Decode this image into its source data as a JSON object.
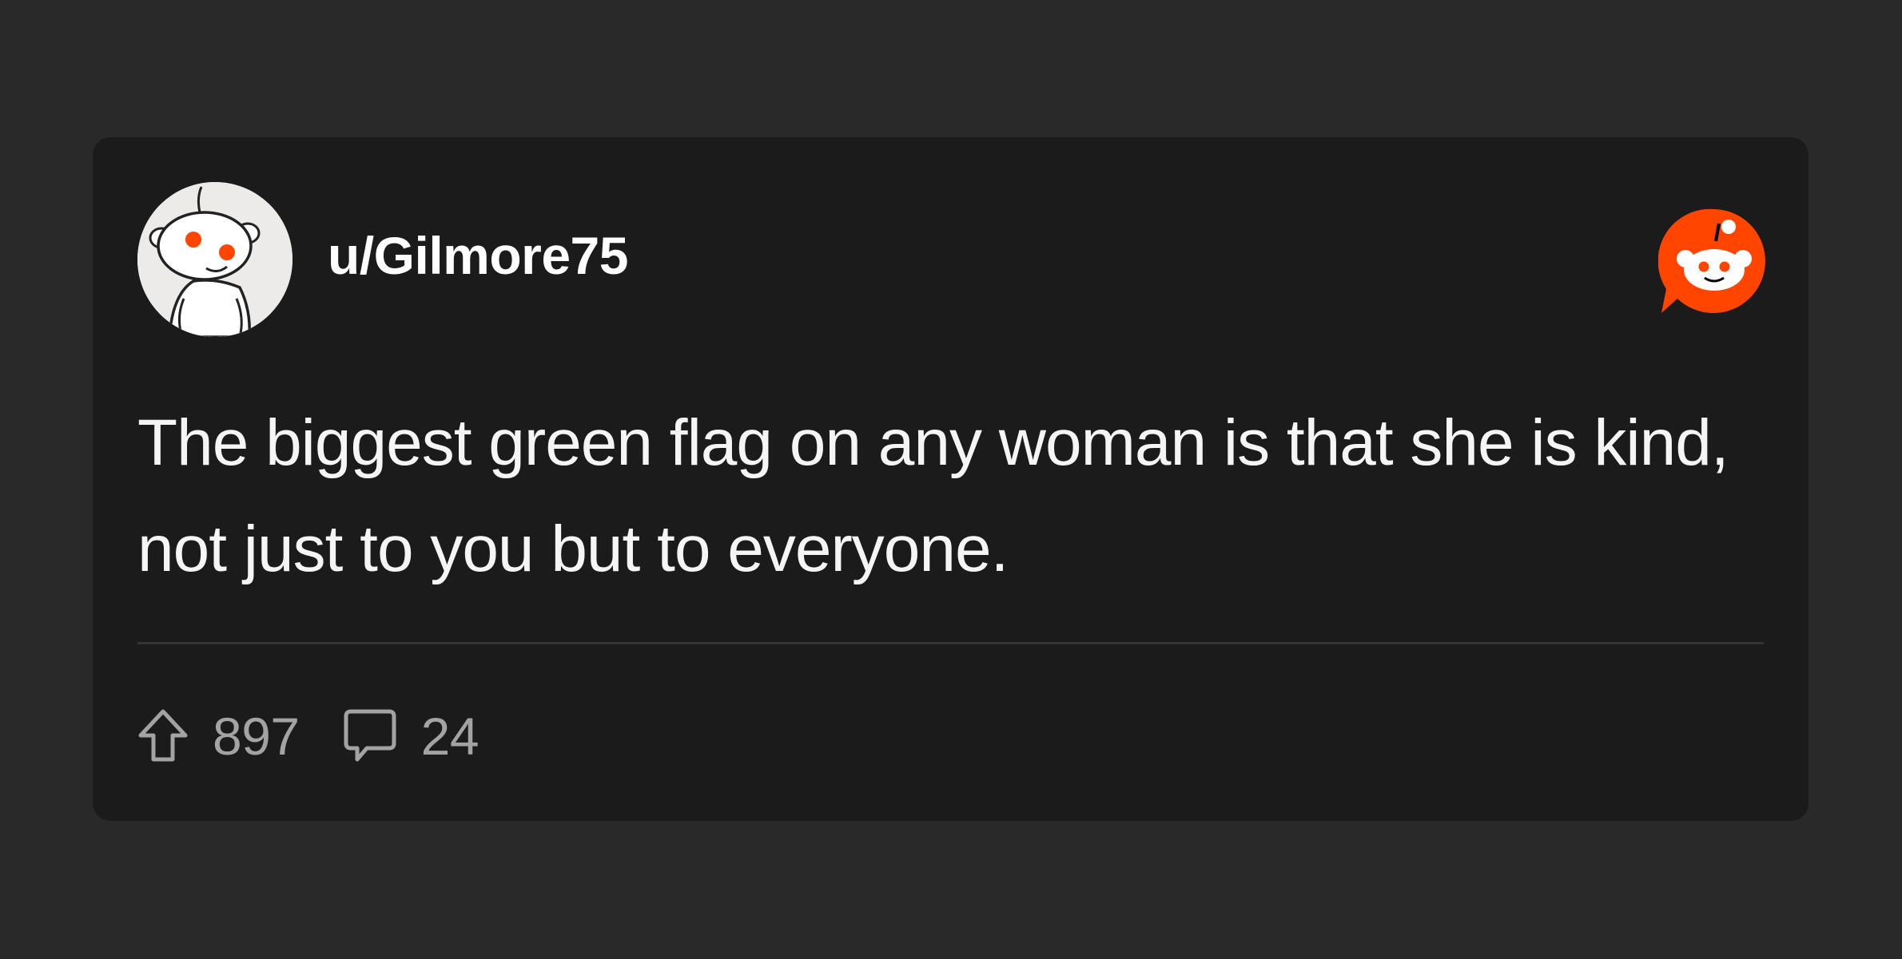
{
  "post": {
    "username": "u/Gilmore75",
    "text": "The biggest green flag on any woman is that she is kind, not just to you but to everyone.",
    "upvotes": "897",
    "comments": "24"
  },
  "icons": {
    "avatar": "reddit-snoo-avatar",
    "brand": "reddit-logo-icon",
    "upvote": "upvote-arrow-icon",
    "comment": "comment-bubble-icon"
  },
  "colors": {
    "page_background": "#292929",
    "card_background": "#1b1b1c",
    "brand_orange": "#ff4500",
    "text_primary": "#ffffff",
    "text_secondary": "#a3a3a3"
  }
}
